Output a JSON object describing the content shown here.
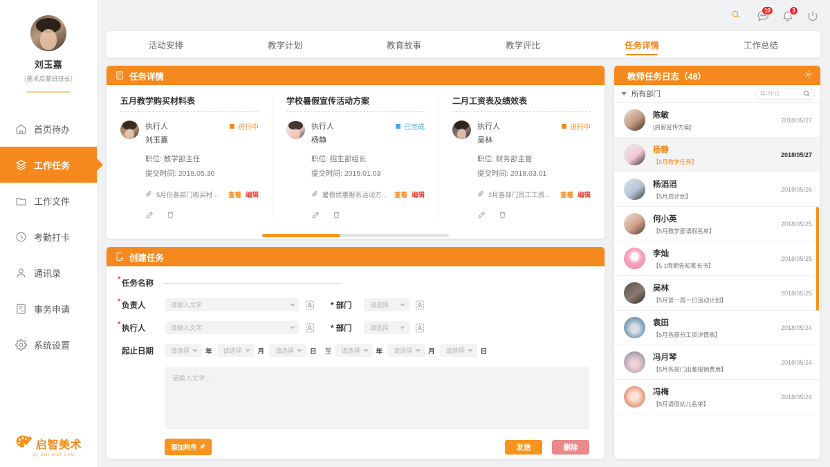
{
  "sidebar": {
    "user": {
      "name": "刘玉嘉",
      "role": "（美术启蒙班班长）"
    },
    "items": [
      {
        "label": "首页待办",
        "icon": "home-icon",
        "active": false
      },
      {
        "label": "工作任务",
        "icon": "layers-icon",
        "active": true
      },
      {
        "label": "工作文件",
        "icon": "folder-icon",
        "active": false
      },
      {
        "label": "考勤打卡",
        "icon": "clock-icon",
        "active": false
      },
      {
        "label": "通讯录",
        "icon": "person-icon",
        "active": false
      },
      {
        "label": "事务申请",
        "icon": "form-icon",
        "active": false
      },
      {
        "label": "系统设置",
        "icon": "gear-icon",
        "active": false
      }
    ],
    "brand": {
      "name": "启智美术",
      "pinyin": "QI ZHI MEI SHU"
    }
  },
  "topbar": {
    "search_placeholder": "",
    "message_badge": "10",
    "notification_badge": "3"
  },
  "tabs": [
    {
      "label": "活动安排",
      "active": false
    },
    {
      "label": "教学计划",
      "active": false
    },
    {
      "label": "教育故事",
      "active": false
    },
    {
      "label": "教学评比",
      "active": false
    },
    {
      "label": "任务详情",
      "active": true
    },
    {
      "label": "工作总结",
      "active": false
    }
  ],
  "task_detail": {
    "title": "任务详情",
    "labels": {
      "executor": "执行人",
      "position": "职位: ",
      "submit_time": "提交时间: ",
      "view": "查看",
      "edit": "编辑"
    },
    "cards": [
      {
        "title": "五月教学购买材料表",
        "executor_label": "执行人",
        "executor_name": "刘玉嘉",
        "status": "进行中",
        "status_type": "running",
        "position": "职位: 教学部主任",
        "submit_time": "提交时间: 2018.05.30",
        "attachment": "5月份各部门购买材 ...",
        "view": "查看",
        "edit": "编辑"
      },
      {
        "title": "学校暑假宣传活动方案",
        "executor_label": "执行人",
        "executor_name": "杨静",
        "status": "已完成",
        "status_type": "done",
        "position": "职位: 招生部组长",
        "submit_time": "提交时间: 2019.01.03",
        "attachment": "暑假优惠报名活动方...",
        "view": "查看",
        "edit": "编辑"
      },
      {
        "title": "二月工资表及绩效表",
        "executor_label": "执行人",
        "executor_name": "吴林",
        "status": "进行中",
        "status_type": "running",
        "position": "职位: 财务部主管",
        "submit_time": "提交时间: 2018.03.01",
        "attachment": "2月各部门员工工资...",
        "view": "查看",
        "edit": "编辑"
      }
    ],
    "carousel_progress": "42"
  },
  "create_task": {
    "title": "创建任务",
    "fields": {
      "task_name_label": "任务名称",
      "owner_label": "负责人",
      "owner_placeholder": "请输入文字",
      "owner_dept_label": "部门",
      "owner_dept_placeholder": "请选择",
      "executor_label": "执行人",
      "executor_placeholder": "请输入文字",
      "executor_dept_label": "部门",
      "executor_dept_placeholder": "请选择",
      "date_label": "起止日期",
      "date_placeholder": "请选择",
      "unit_year": "年",
      "unit_month": "月",
      "unit_day": "日",
      "date_separator": "至",
      "content_placeholder": "请输入文字...."
    },
    "buttons": {
      "attach": "添加附件",
      "send": "发送",
      "delete": "删除"
    }
  },
  "log_panel": {
    "title": "教师任务日志（48）",
    "filter_department": "所有部门",
    "date_placeholder": "年/月/日",
    "items": [
      {
        "name": "陈敏",
        "task": "[启智宣传方案]",
        "date": "2018/05/27",
        "active": false
      },
      {
        "name": "杨静",
        "task": "【5月教学任务】",
        "date": "2018/05/27",
        "active": true
      },
      {
        "name": "杨滔滔",
        "task": "【5月周计划】",
        "date": "2018/05/26",
        "active": false
      },
      {
        "name": "何小英",
        "task": "【5月教学部请假名单】",
        "date": "2018/05/25",
        "active": false
      },
      {
        "name": "李灿",
        "task": "【5.1假期告知家长书】",
        "date": "2018/05/25",
        "active": false
      },
      {
        "name": "吴林",
        "task": "【5月第一周一日活动计划】",
        "date": "2018/05/25",
        "active": false
      },
      {
        "name": "袁田",
        "task": "【5月各部分工资详情表】",
        "date": "2018/05/24",
        "active": false
      },
      {
        "name": "冯月琴",
        "task": "【5月各部门出差报销费用】",
        "date": "2018/05/24",
        "active": false
      },
      {
        "name": "冯梅",
        "task": "【5月请假幼儿名单】",
        "date": "2018/05/24",
        "active": false
      }
    ]
  },
  "colors": {
    "accent": "#f5891d",
    "accent_light": "#f7941d",
    "danger": "#e8443a",
    "delete_btn": "#e8898a",
    "done_blue": "#4aa8e8",
    "badge_red": "#e8262a"
  }
}
